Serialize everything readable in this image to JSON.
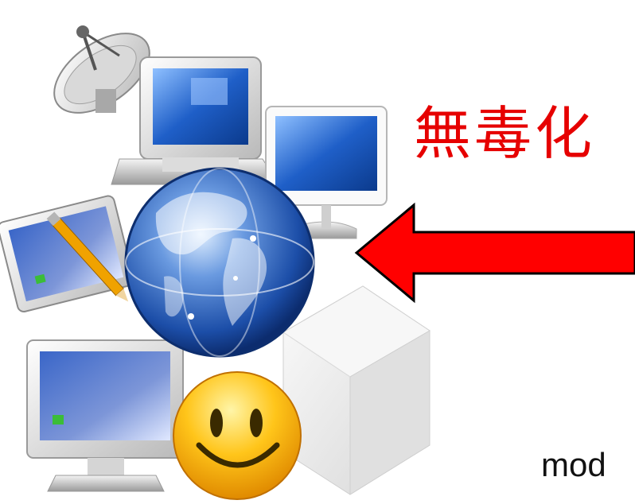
{
  "slide": {
    "title": "無毒化",
    "caption": "mod"
  },
  "colors": {
    "title": "#e60000",
    "arrow_fill": "#ff0000",
    "arrow_stroke": "#000000",
    "globe": "#2a63c4",
    "screen": "#1f5fc8",
    "smiley": "#ffc51a"
  },
  "icons": {
    "satellite": "satellite-dish-icon",
    "monitor_top": "crt-monitor-icon",
    "imac": "imac-icon",
    "tablet": "tablet-pen-icon",
    "globe": "globe-icon",
    "monitor_bottom": "desktop-monitor-icon",
    "smiley": "smiley-face-icon",
    "cube": "white-cube-icon",
    "arrow": "left-arrow-icon"
  }
}
